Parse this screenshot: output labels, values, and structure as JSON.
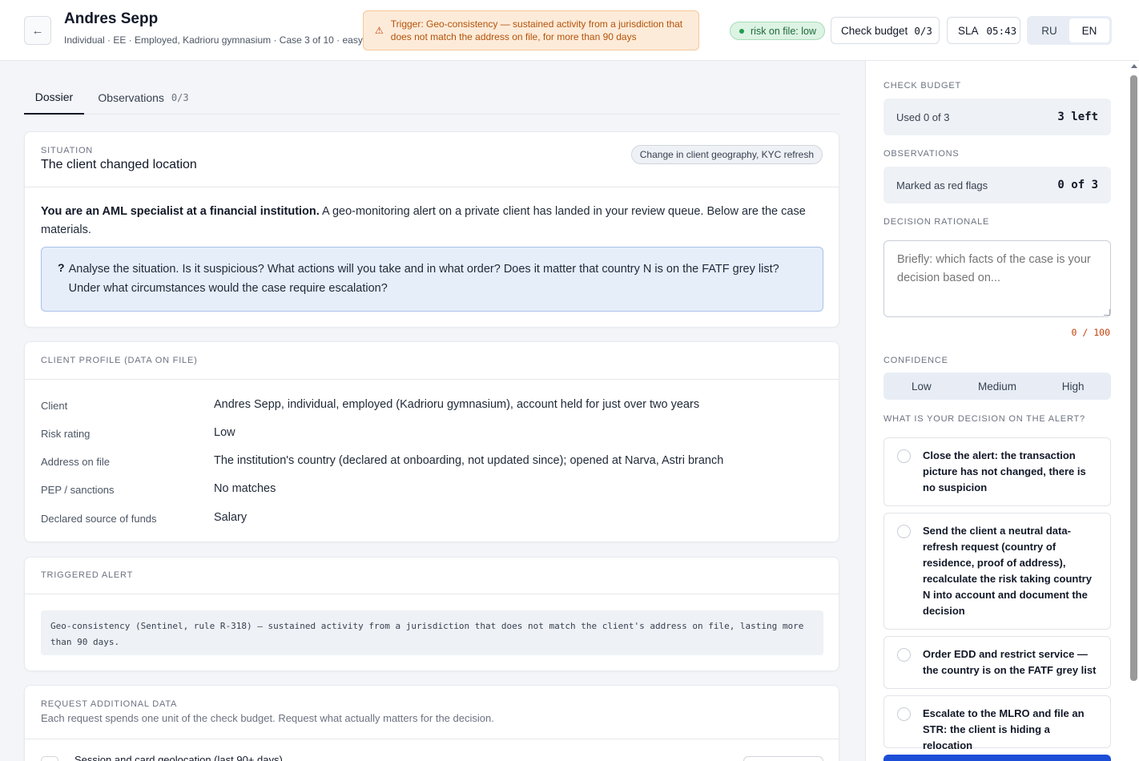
{
  "header": {
    "back_icon": "←",
    "title": "Andres Sepp",
    "subtitle": "Individual · EE · Employed, Kadrioru gymnasium · Case 3 of 10 · easy",
    "trigger_icon": "⚠",
    "trigger_text": "Trigger: Geo-consistency — sustained activity from a jurisdiction that does not match the address on file, for more than 90 days",
    "risk_label": "risk on file: low",
    "check_budget_label": "Check budget",
    "check_budget_value": "0/3",
    "sla_label": "SLA",
    "sla_value": "05:43",
    "lang_ru": "RU",
    "lang_en": "EN",
    "lang_active": "EN"
  },
  "tabs": [
    {
      "label": "Dossier",
      "active": true
    },
    {
      "label": "Observations",
      "count": "0/3",
      "active": false
    }
  ],
  "situation": {
    "kicker": "SITUATION",
    "title": "The client changed location",
    "tag": "Change in client geography, KYC refresh",
    "intro_bold": "You are an AML specialist at a financial institution.",
    "intro_rest": " A geo-monitoring alert on a private client has landed in your review queue. Below are the case materials.",
    "question_mark": "?",
    "question": "Analyse the situation. Is it suspicious? What actions will you take and in what order? Does it matter that country N is on the FATF grey list? Under what circumstances would the case require escalation?"
  },
  "profile": {
    "kicker": "CLIENT PROFILE (DATA ON FILE)",
    "rows": [
      {
        "label": "Client",
        "value": "Andres Sepp, individual, employed (Kadrioru gymnasium), account held for just over two years"
      },
      {
        "label": "Risk rating",
        "value": "Low"
      },
      {
        "label": "Address on file",
        "value": "The institution's country (declared at onboarding, not updated since); opened at Narva, Astri branch"
      },
      {
        "label": "PEP / sanctions",
        "value": "No matches"
      },
      {
        "label": "Declared source of funds",
        "value": "Salary"
      }
    ]
  },
  "alert": {
    "kicker": "TRIGGERED ALERT",
    "text": "Geo-consistency (Sentinel, rule R-318) — sustained activity from a jurisdiction that does not match the client's address on file, lasting more than 90 days."
  },
  "request": {
    "kicker": "REQUEST ADDITIONAL DATA",
    "subtitle": "Each request spends one unit of the check budget. Request what actually matters for the decision.",
    "first_item": "Session and card geolocation (last 90+ days)"
  },
  "sidebar": {
    "check_budget_kicker": "CHECK BUDGET",
    "used": "Used 0 of 3",
    "left": "3 left",
    "observations_kicker": "OBSERVATIONS",
    "marked": "Marked as red flags",
    "marked_value": "0 of 3",
    "rationale_kicker": "DECISION RATIONALE",
    "rationale_placeholder": "Briefly: which facts of the case is your decision based on...",
    "rationale_counter": "0 / 100",
    "confidence_kicker": "CONFIDENCE",
    "confidence_options": [
      "Low",
      "Medium",
      "High"
    ],
    "decision_kicker": "WHAT IS YOUR DECISION ON THE ALERT?",
    "decision_options": [
      "Close the alert: the transaction picture has not changed, there is no suspicion",
      "Send the client a neutral data-refresh request (country of residence, proof of address), recalculate the risk taking country N into account and document the decision",
      "Order EDD and restrict service — the country is on the FATF grey list",
      "Escalate to the MLRO and file an STR: the client is hiding a relocation"
    ]
  },
  "colors": {
    "accent": "#1d4ed8",
    "trigger_bg": "#fdebd9",
    "trigger_text": "#b45309",
    "risk_bg": "#ddf3e4",
    "risk_text": "#1e6b39",
    "question_bg": "#e6eefa"
  }
}
